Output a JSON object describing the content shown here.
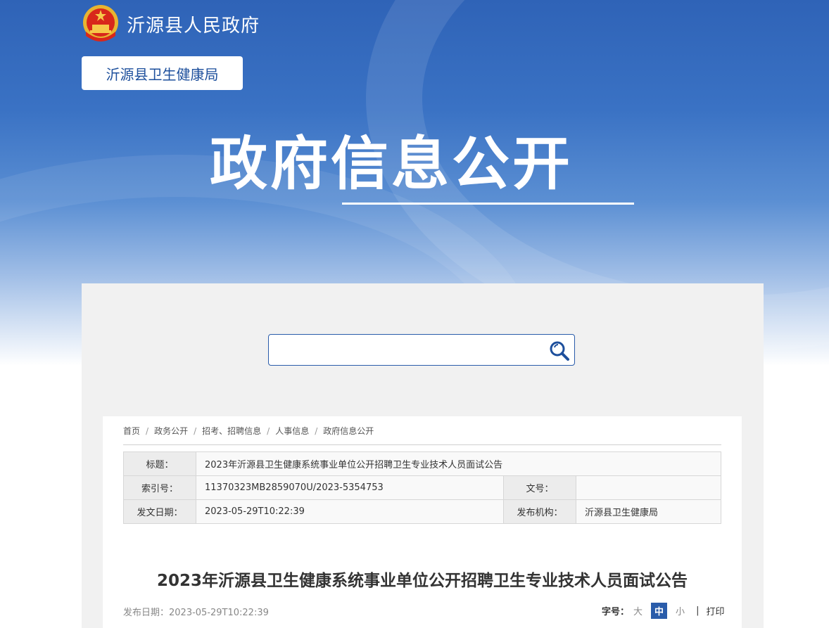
{
  "header": {
    "site_title": "沂源县人民政府",
    "department": "沂源县卫生健康局",
    "section_title": "政府信息公开"
  },
  "search": {
    "placeholder": "",
    "value": ""
  },
  "breadcrumb": [
    "首页",
    "政务公开",
    "招考、招聘信息",
    "人事信息",
    "政府信息公开"
  ],
  "meta": {
    "title_label": "标题：",
    "title_value": "2023年沂源县卫生健康系统事业单位公开招聘卫生专业技术人员面试公告",
    "index_label": "索引号：",
    "index_value": "11370323MB2859070U/2023-5354753",
    "docno_label": "文号：",
    "docno_value": "",
    "date_label": "发文日期：",
    "date_value": "2023-05-29T10:22:39",
    "org_label": "发布机构：",
    "org_value": "沂源县卫生健康局"
  },
  "article": {
    "title": "2023年沂源县卫生健康系统事业单位公开招聘卫生专业技术人员面试公告",
    "pub_date": "发布日期：2023-05-29T10:22:39"
  },
  "font_controls": {
    "label": "字号：",
    "large": "大",
    "medium": "中",
    "small": "小",
    "separator": "|",
    "print": "打印"
  },
  "colors": {
    "brand_blue": "#2a5caa",
    "banner_blue": "#2f63b7"
  },
  "icons": {
    "emblem": "national-emblem-icon",
    "search": "search-icon"
  }
}
